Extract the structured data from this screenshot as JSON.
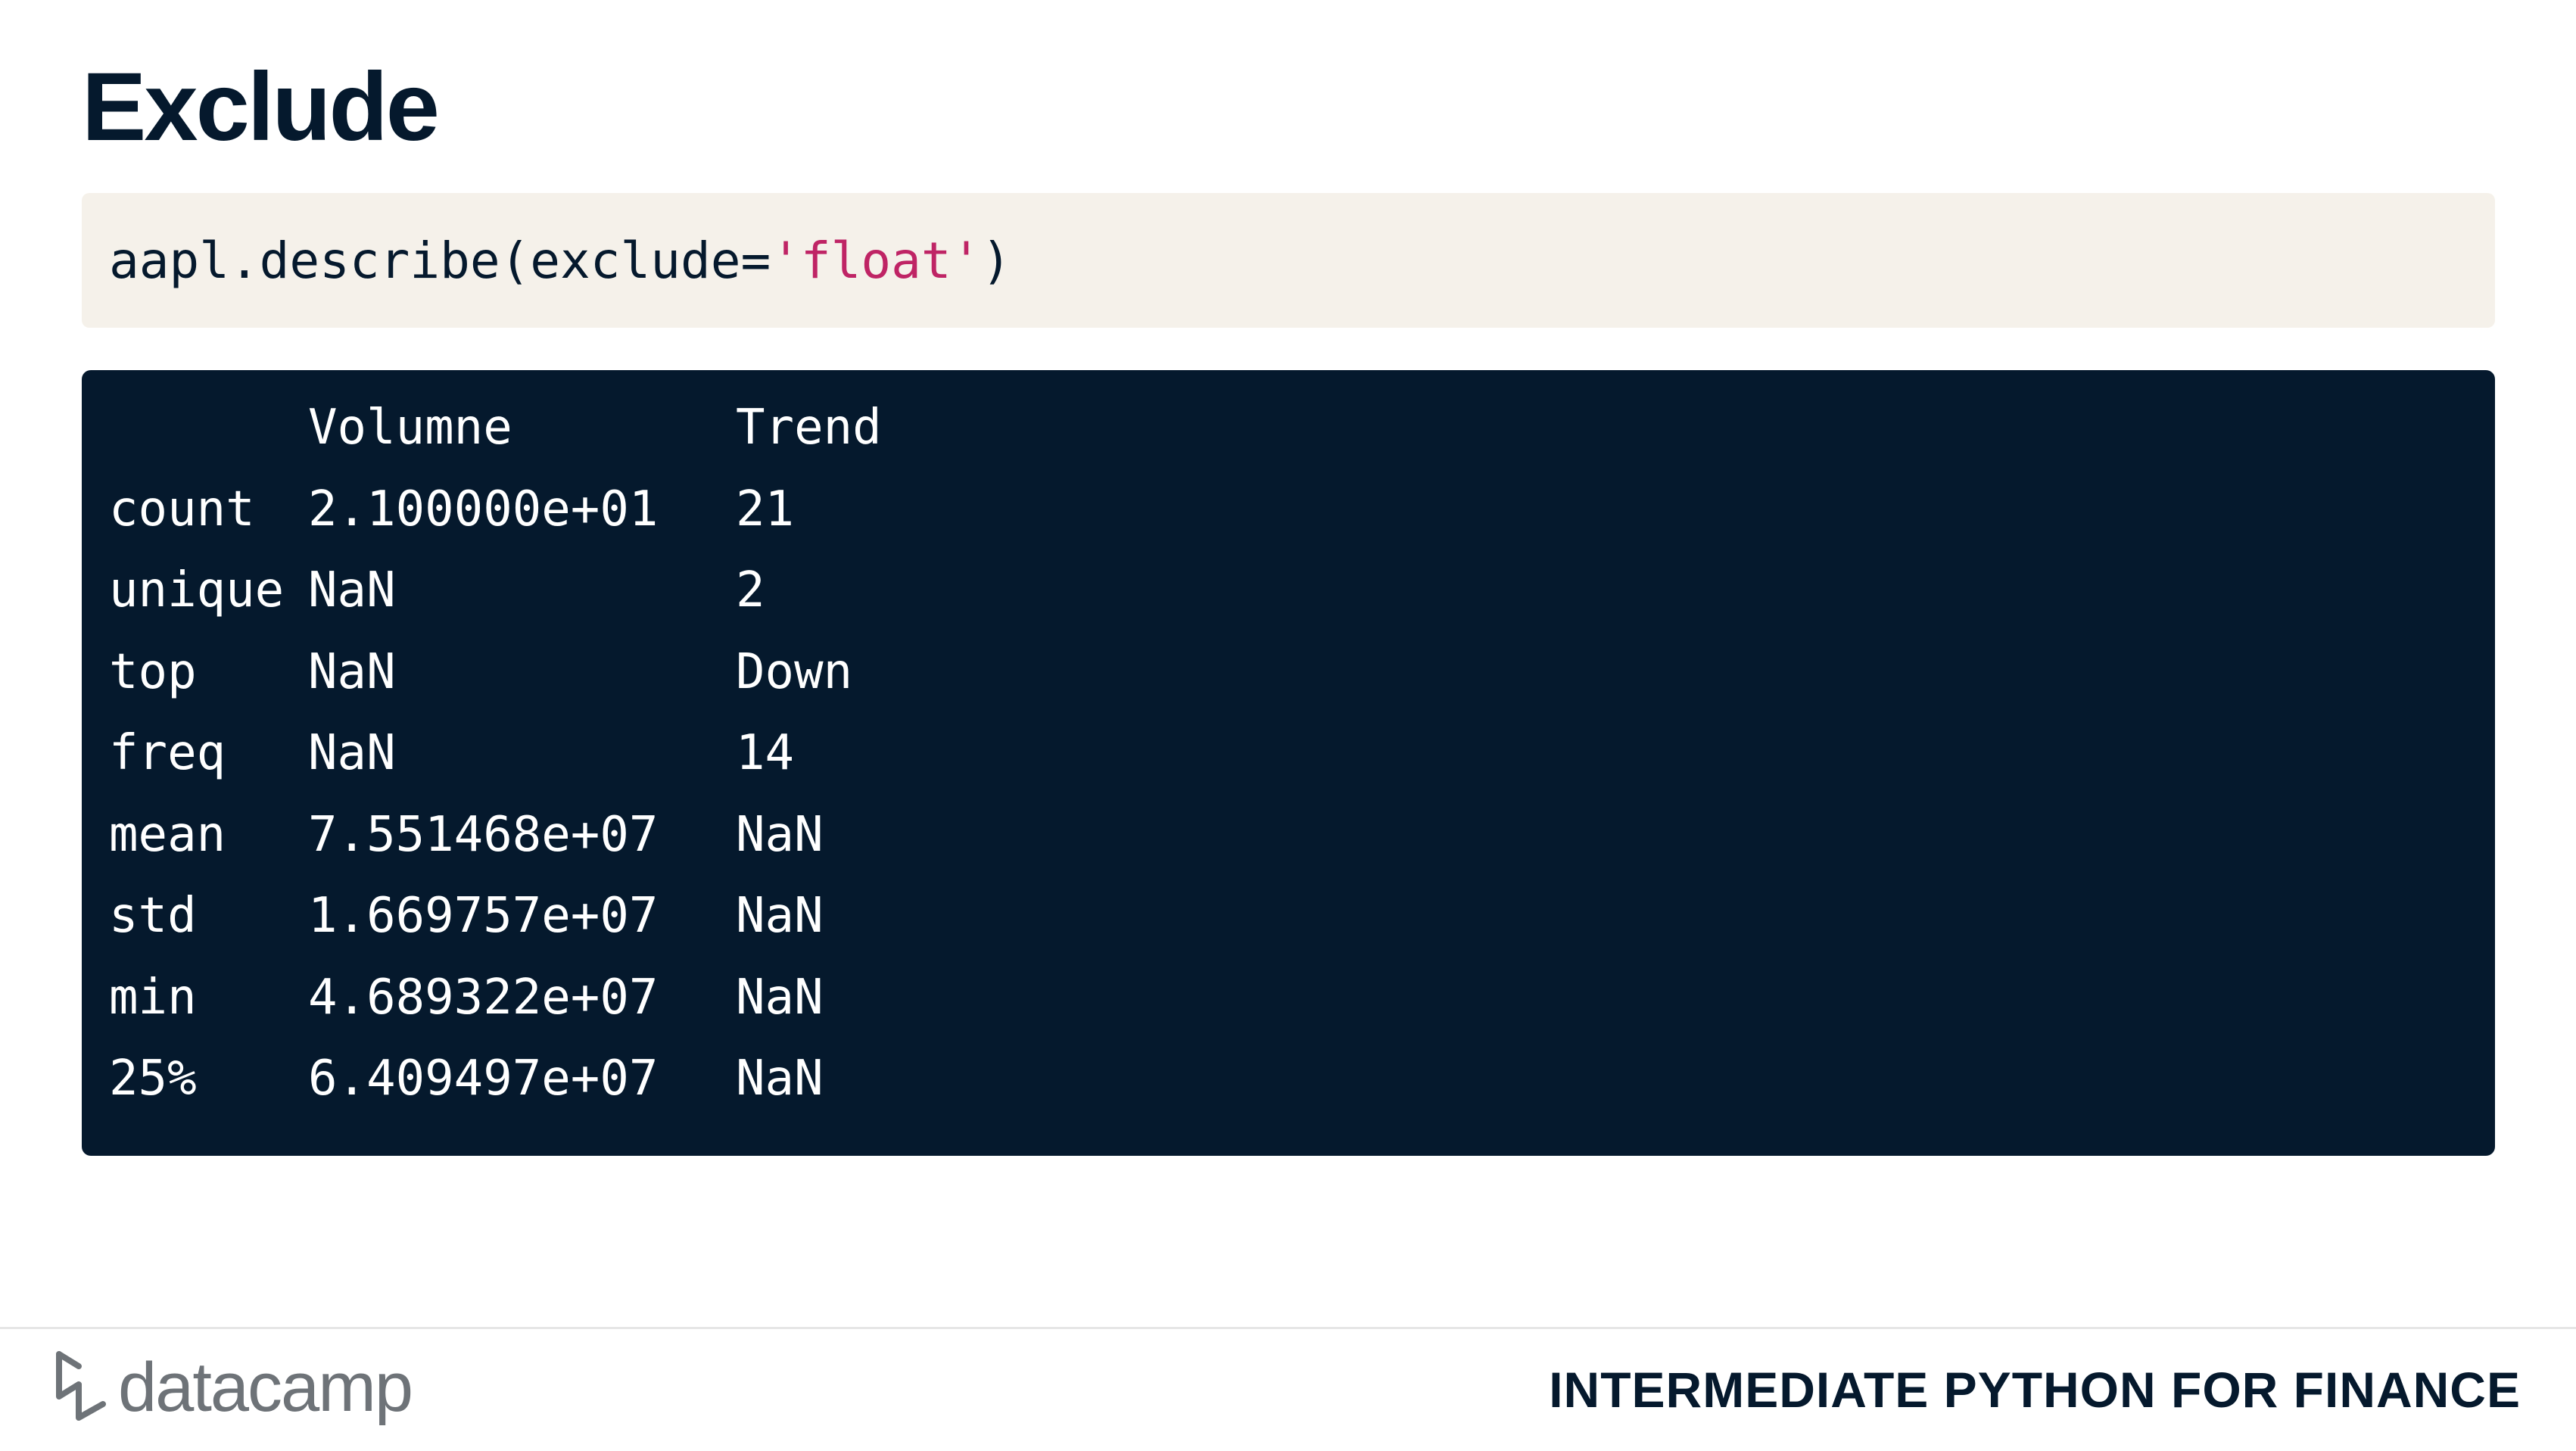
{
  "slide": {
    "title": "Exclude"
  },
  "code_input": {
    "prefix": "aapl.describe(exclude=",
    "string_literal": "'float'",
    "suffix": ")"
  },
  "code_output": {
    "header": [
      "",
      "Volumne",
      "Trend"
    ],
    "rows": [
      [
        "count",
        "2.100000e+01",
        "21"
      ],
      [
        "unique",
        "NaN",
        "2"
      ],
      [
        "top",
        "NaN",
        "Down"
      ],
      [
        "freq",
        "NaN",
        "14"
      ],
      [
        "mean",
        "7.551468e+07",
        "NaN"
      ],
      [
        "std",
        "1.669757e+07",
        "NaN"
      ],
      [
        "min",
        "4.689322e+07",
        "NaN"
      ],
      [
        "25%",
        "6.409497e+07",
        "NaN"
      ]
    ]
  },
  "footer": {
    "logo_text": "datacamp",
    "logo_icon": "datacamp-logo-icon",
    "course_title": "INTERMEDIATE PYTHON FOR FINANCE"
  },
  "colors": {
    "navy": "#05192d",
    "code_bg": "#f5f1ea",
    "string": "#bf2465",
    "logo_gray": "#6e7378"
  }
}
